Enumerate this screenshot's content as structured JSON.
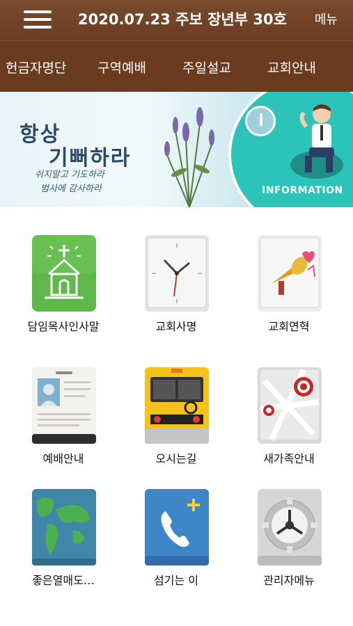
{
  "header": {
    "title": "2020.07.23 주보 장년부 30호",
    "menu_label": "메뉴"
  },
  "tabs": [
    {
      "label": "헌금자명단"
    },
    {
      "label": "구역예배"
    },
    {
      "label": "주일설교"
    },
    {
      "label": "교회안내",
      "active": true
    }
  ],
  "banner": {
    "line1": "항상",
    "line2": "기뻐하라",
    "line3": "쉬지말고 기도하라",
    "line4": "범사에 감사하라",
    "info_label": "INFORMATION"
  },
  "grid": [
    {
      "label": "담임목사인사말",
      "icon": "church-icon"
    },
    {
      "label": "교회사명",
      "icon": "clock-icon"
    },
    {
      "label": "교회연혁",
      "icon": "trumpet-icon"
    },
    {
      "label": "예배안내",
      "icon": "id-card-icon"
    },
    {
      "label": "오시는길",
      "icon": "bus-icon"
    },
    {
      "label": "새가족안내",
      "icon": "map-pin-icon"
    },
    {
      "label": "좋은열매도…",
      "icon": "globe-icon"
    },
    {
      "label": "섬기는 이",
      "icon": "phone-add-icon"
    },
    {
      "label": "관리자메뉴",
      "icon": "gear-icon"
    }
  ],
  "colors": {
    "header_bg": "#6b3d22",
    "tab_active_underline": "#e86aa8",
    "banner_accent": "#2cc3b8"
  }
}
